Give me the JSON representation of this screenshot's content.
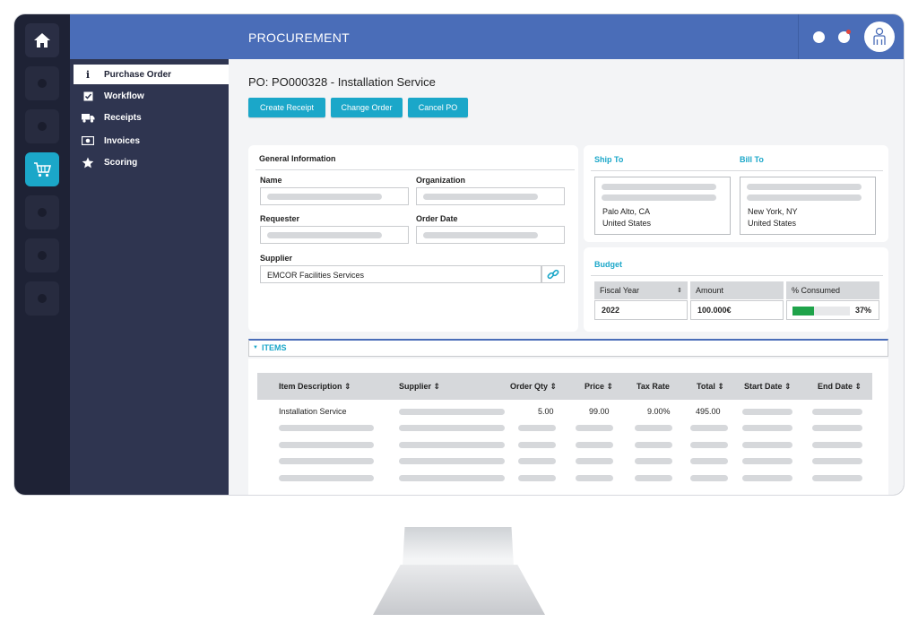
{
  "app": {
    "title": "PROCUREMENT"
  },
  "subnav": {
    "items": [
      {
        "label": "Purchase Order",
        "icon": "info-icon",
        "active": true
      },
      {
        "label": "Workflow",
        "icon": "checkbox-icon",
        "active": false
      },
      {
        "label": "Receipts",
        "icon": "truck-icon",
        "active": false
      },
      {
        "label": "Invoices",
        "icon": "money-icon",
        "active": false
      },
      {
        "label": "Scoring",
        "icon": "star-icon",
        "active": false
      }
    ]
  },
  "po": {
    "title": "PO: PO000328 - Installation Service",
    "actions": {
      "create_receipt": "Create Receipt",
      "change_order": "Change Order",
      "cancel_po": "Cancel PO"
    }
  },
  "general": {
    "heading": "General Information",
    "name_label": "Name",
    "organization_label": "Organization",
    "requester_label": "Requester",
    "order_date_label": "Order Date",
    "supplier_label": "Supplier",
    "supplier_value": "EMCOR Facilities Services"
  },
  "shipping": {
    "ship_to_heading": "Ship To",
    "bill_to_heading": "Bill To",
    "ship_to_city": "Palo Alto, CA",
    "ship_to_country": "United States",
    "bill_to_city": "New York, NY",
    "bill_to_country": "United States"
  },
  "budget": {
    "heading": "Budget",
    "fiscal_year_label": "Fiscal Year",
    "amount_label": "Amount",
    "consumed_label": "% Consumed",
    "fiscal_year": "2022",
    "amount": "100.000€",
    "consumed": "37%",
    "consumed_fraction": 0.37,
    "consumed_color": "#1fa34a"
  },
  "items": {
    "heading": "ITEMS",
    "columns": [
      "Item Description",
      "Supplier",
      "Order Qty",
      "Price",
      "Tax Rate",
      "Total",
      "Start Date",
      "End Date"
    ],
    "row": {
      "description": "Installation Service",
      "qty": "5.00",
      "price": "99.00",
      "tax_rate": "9.00%",
      "total": "495.00"
    }
  },
  "colors": {
    "accent": "#1ba7c9",
    "topbar": "#4a6db8",
    "rail": "#1e2235",
    "subnav": "#2f3550"
  }
}
